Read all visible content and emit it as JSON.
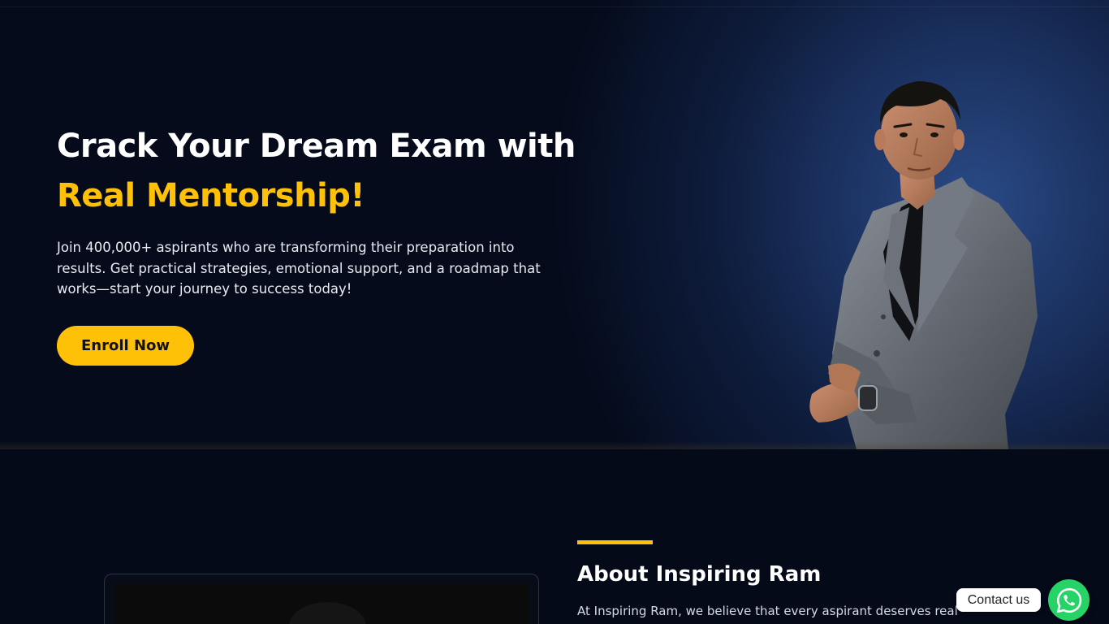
{
  "hero": {
    "title_line1": "Crack Your Dream Exam with",
    "title_line2": "Real Mentorship!",
    "description": "Join 400,000+ aspirants who are transforming their preparation into results. Get practical strategies, emotional support, and a roadmap that works—start your journey to success today!",
    "cta_label": "Enroll Now"
  },
  "about": {
    "title": "About Inspiring Ram",
    "intro": "At Inspiring Ram, we believe that every aspirant deserves real"
  },
  "contact": {
    "label": "Contact us",
    "icon": "whatsapp-icon"
  },
  "colors": {
    "accent": "#ffc107",
    "background": "#040a18",
    "whatsapp": "#25d366"
  }
}
